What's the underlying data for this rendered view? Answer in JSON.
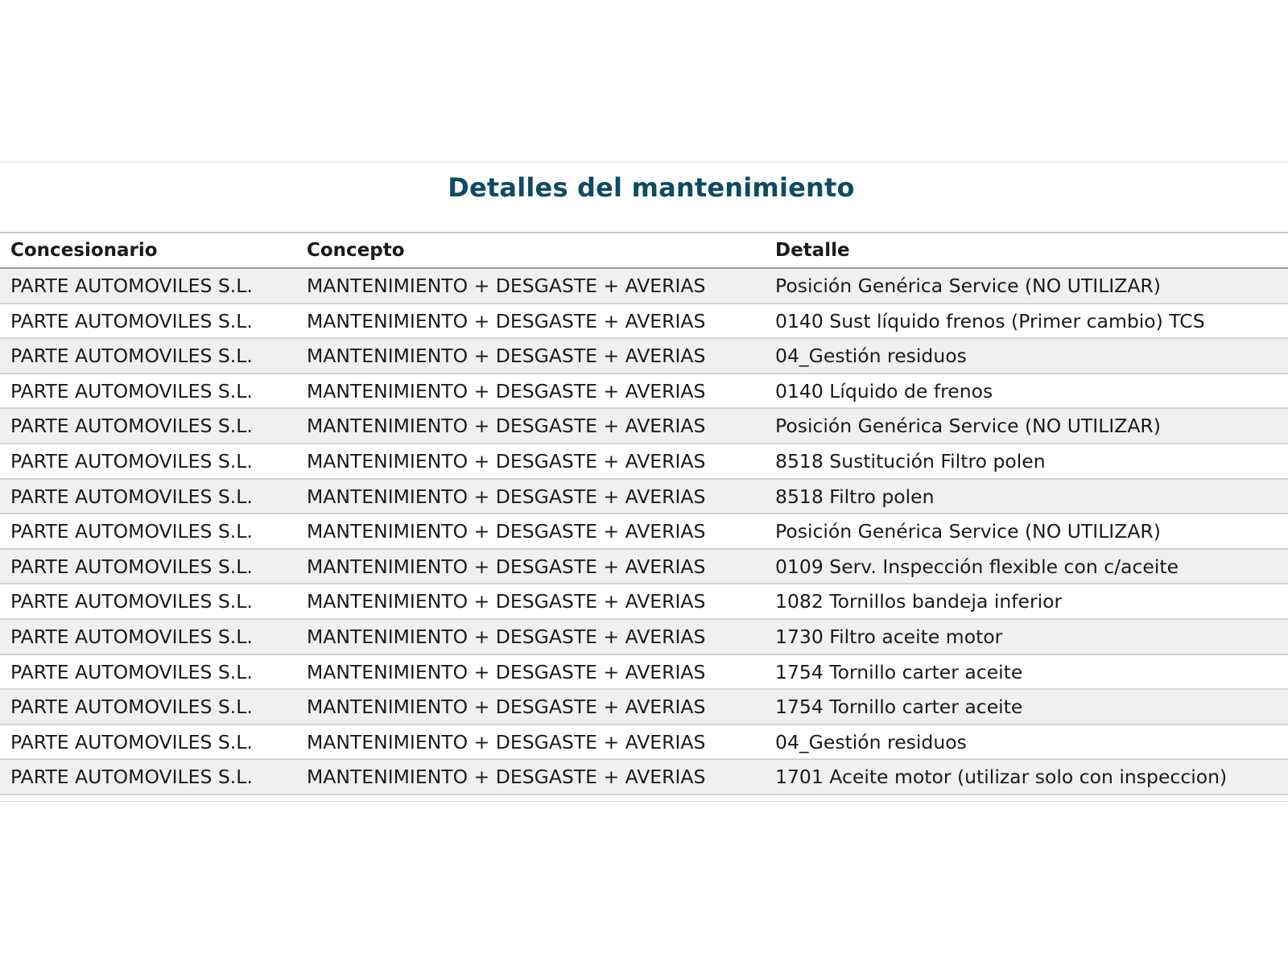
{
  "title": "Detalles del mantenimiento",
  "columns": [
    "Concesionario",
    "Concepto",
    "Detalle"
  ],
  "rows": [
    [
      "PARTE AUTOMOVILES S.L.",
      "MANTENIMIENTO + DESGASTE + AVERIAS",
      "Posición Genérica Service (NO UTILIZAR)"
    ],
    [
      "PARTE AUTOMOVILES S.L.",
      "MANTENIMIENTO + DESGASTE + AVERIAS",
      "0140 Sust líquido frenos (Primer cambio) TCS"
    ],
    [
      "PARTE AUTOMOVILES S.L.",
      "MANTENIMIENTO + DESGASTE + AVERIAS",
      "04_Gestión residuos"
    ],
    [
      "PARTE AUTOMOVILES S.L.",
      "MANTENIMIENTO + DESGASTE + AVERIAS",
      "0140 Líquido de frenos"
    ],
    [
      "PARTE AUTOMOVILES S.L.",
      "MANTENIMIENTO + DESGASTE + AVERIAS",
      "Posición Genérica Service (NO UTILIZAR)"
    ],
    [
      "PARTE AUTOMOVILES S.L.",
      "MANTENIMIENTO + DESGASTE + AVERIAS",
      "8518 Sustitución Filtro polen"
    ],
    [
      "PARTE AUTOMOVILES S.L.",
      "MANTENIMIENTO + DESGASTE + AVERIAS",
      "8518 Filtro polen"
    ],
    [
      "PARTE AUTOMOVILES S.L.",
      "MANTENIMIENTO + DESGASTE + AVERIAS",
      "Posición Genérica Service (NO UTILIZAR)"
    ],
    [
      "PARTE AUTOMOVILES S.L.",
      "MANTENIMIENTO + DESGASTE + AVERIAS",
      "0109 Serv. Inspección flexible con c/aceite"
    ],
    [
      "PARTE AUTOMOVILES S.L.",
      "MANTENIMIENTO + DESGASTE + AVERIAS",
      "1082 Tornillos bandeja inferior"
    ],
    [
      "PARTE AUTOMOVILES S.L.",
      "MANTENIMIENTO + DESGASTE + AVERIAS",
      "1730 Filtro aceite motor"
    ],
    [
      "PARTE AUTOMOVILES S.L.",
      "MANTENIMIENTO + DESGASTE + AVERIAS",
      "1754 Tornillo carter aceite"
    ],
    [
      "PARTE AUTOMOVILES S.L.",
      "MANTENIMIENTO + DESGASTE + AVERIAS",
      "1754 Tornillo carter aceite"
    ],
    [
      "PARTE AUTOMOVILES S.L.",
      "MANTENIMIENTO + DESGASTE + AVERIAS",
      "04_Gestión residuos"
    ],
    [
      "PARTE AUTOMOVILES S.L.",
      "MANTENIMIENTO + DESGASTE + AVERIAS",
      "1701 Aceite motor (utilizar solo con inspeccion)"
    ]
  ],
  "colors": {
    "title": "#0d4b63",
    "row_alt": "#f0f0f0",
    "row_border": "#d4d4d4"
  }
}
